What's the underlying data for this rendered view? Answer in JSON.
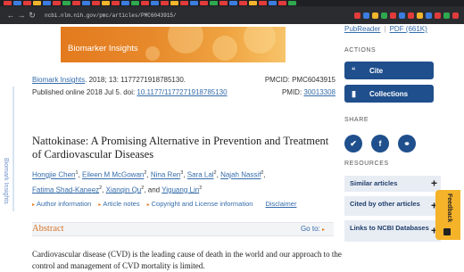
{
  "browser": {
    "url": "ncbi.nlm.nih.gov/pmc/articles/PMC6043915/",
    "back_icon": "arrow-left-icon",
    "forward_icon": "arrow-right-icon",
    "reload_icon": "reload-icon",
    "tab_colors": [
      "#e23b3b",
      "#3c7de0",
      "#e23b3b",
      "#f0b52c",
      "#3c7de0",
      "#e23b3b",
      "#2fa84f",
      "#e23b3b",
      "#3c7de0",
      "#e23b3b",
      "#f0b52c",
      "#e23b3b",
      "#3c7de0",
      "#2fa84f",
      "#e23b3b",
      "#3c7de0",
      "#e23b3b",
      "#f0b52c",
      "#e23b3b",
      "#3c7de0",
      "#e23b3b",
      "#2fa84f",
      "#e23b3b",
      "#3c7de0",
      "#e23b3b",
      "#f0b52c",
      "#e23b3b",
      "#3c7de0",
      "#e23b3b",
      "#2fa84f"
    ],
    "bookmark_colors": [
      "#e23b3b",
      "#3c7de0",
      "#f0b52c",
      "#2fa84f",
      "#e23b3b",
      "#3c7de0",
      "#e23b3b",
      "#f0b52c",
      "#3c7de0",
      "#e23b3b",
      "#2fa84f",
      "#e23b3b"
    ]
  },
  "journal": {
    "banner_title": "Biomarker Insights",
    "side_label": "Biomark Insights",
    "banner_color": "#e7892b"
  },
  "citation": {
    "journal_link": "Biomark Insights",
    "details": ". 2018; 13: 1177271918785130.",
    "published_prefix": "Published online 2018 Jul 5. doi: ",
    "doi": "10.1177/1177271918785130",
    "pmcid": "PMCID: PMC6043915",
    "pmid_prefix": "PMID: ",
    "pmid": "30013308"
  },
  "article": {
    "title": "Nattokinase: A Promising Alternative in Prevention and Treatment of Cardiovascular Diseases",
    "authors": [
      {
        "name": "Hongjie Chen",
        "sup": "1"
      },
      {
        "name": "Eileen M McGowan",
        "sup": "2"
      },
      {
        "name": "Nina Ren",
        "sup": "3"
      },
      {
        "name": "Sara Lal",
        "sup": "2"
      },
      {
        "name": "Najah Nassif",
        "sup": "2"
      },
      {
        "name": "Fatima Shad-Kaneez",
        "sup": "2"
      },
      {
        "name": "Xianqin Qu",
        "sup": "2"
      },
      {
        "name": "Yiguang Lin",
        "sup": "2"
      }
    ],
    "and_word": "and"
  },
  "info_links": {
    "author_info": "Author information",
    "article_notes": "Article notes",
    "copyright": "Copyright and License information",
    "disclaimer": "Disclaimer"
  },
  "abstract": {
    "heading": "Abstract",
    "goto": "Go to:",
    "text": "Cardiovascular disease (CVD) is the leading cause of death in the world and our approach to the control and management of CVD mortality is limited."
  },
  "sidebar": {
    "pubreader": "PubReader",
    "pdf": "PDF (661K)",
    "actions_label": "ACTIONS",
    "cite": "Cite",
    "collections": "Collections",
    "share_label": "SHARE",
    "resources_label": "RESOURCES",
    "resources": [
      {
        "label": "Similar articles"
      },
      {
        "label": "Cited by other articles"
      },
      {
        "label": "Links to NCBI Databases"
      }
    ],
    "button_color": "#1f4f8c"
  },
  "feedback": {
    "label": "Feedback"
  }
}
